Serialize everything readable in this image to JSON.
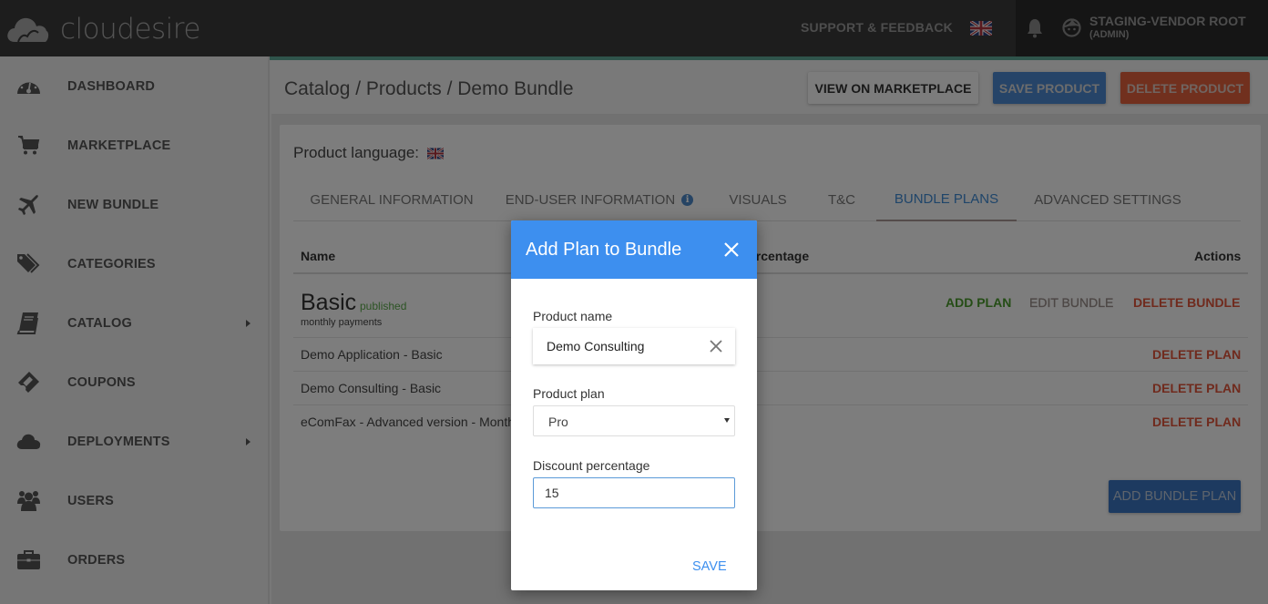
{
  "brand": {
    "name": "cloudesire"
  },
  "topbar": {
    "support_label": "SUPPORT & FEEDBACK",
    "language_flag": "uk-flag-icon",
    "notification_icon": "bell-icon",
    "user_icon": "face-icon",
    "user_name": "STAGING-VENDOR ROOT",
    "user_role": "(ADMIN)"
  },
  "sidebar": {
    "items": [
      {
        "label": "DASHBOARD",
        "icon": "dashboard-icon",
        "has_submenu": false
      },
      {
        "label": "MARKETPLACE",
        "icon": "cart-icon",
        "has_submenu": false
      },
      {
        "label": "NEW BUNDLE",
        "icon": "plane-icon",
        "has_submenu": false
      },
      {
        "label": "CATEGORIES",
        "icon": "tags-icon",
        "has_submenu": false
      },
      {
        "label": "CATALOG",
        "icon": "book-icon",
        "has_submenu": true
      },
      {
        "label": "COUPONS",
        "icon": "ticket-icon",
        "has_submenu": false
      },
      {
        "label": "DEPLOYMENTS",
        "icon": "cloud-icon",
        "has_submenu": true
      },
      {
        "label": "USERS",
        "icon": "users-icon",
        "has_submenu": false
      },
      {
        "label": "ORDERS",
        "icon": "briefcase-icon",
        "has_submenu": false
      }
    ]
  },
  "header": {
    "breadcrumb": "Catalog / Products / Demo Bundle",
    "buttons": {
      "view": "VIEW ON MARKETPLACE",
      "save": "SAVE PRODUCT",
      "delete": "DELETE PRODUCT"
    }
  },
  "product": {
    "language_label": "Product language:",
    "tabs": [
      {
        "label": "GENERAL INFORMATION",
        "active": false
      },
      {
        "label": "END-USER INFORMATION",
        "active": false,
        "has_info_icon": true
      },
      {
        "label": "VISUALS",
        "active": false
      },
      {
        "label": "T&C",
        "active": false
      },
      {
        "label": "BUNDLE PLANS",
        "active": true
      },
      {
        "label": "ADVANCED SETTINGS",
        "active": false
      }
    ],
    "table": {
      "columns": {
        "name": "Name",
        "discount": "Discount percentage",
        "discount_visible": "ercentage",
        "actions": "Actions"
      },
      "bundle": {
        "name": "Basic",
        "status": "published",
        "billing": "monthly payments",
        "actions": {
          "add_plan": "ADD PLAN",
          "edit_bundle": "EDIT BUNDLE",
          "delete_bundle": "DELETE BUNDLE"
        }
      },
      "plans": [
        {
          "name": "Demo Application - Basic",
          "action": "DELETE PLAN"
        },
        {
          "name": "Demo Consulting - Basic",
          "action": "DELETE PLAN"
        },
        {
          "name": "eComFax - Advanced version - Month",
          "action": "DELETE PLAN"
        }
      ]
    },
    "add_bundle_plan_label": "ADD BUNDLE PLAN"
  },
  "modal": {
    "title": "Add Plan to Bundle",
    "fields": {
      "product_name_label": "Product name",
      "product_name_value": "Demo Consulting",
      "product_plan_label": "Product plan",
      "product_plan_value": "Pro",
      "discount_label": "Discount percentage",
      "discount_value": "15"
    },
    "save_label": "SAVE"
  },
  "colors": {
    "modal_header": "#3d8fef",
    "accent_line": "#5fa896",
    "save_product": "#4d89d0",
    "delete_product": "#e2613c",
    "published": "#5aa84a",
    "danger": "#e0553a"
  }
}
